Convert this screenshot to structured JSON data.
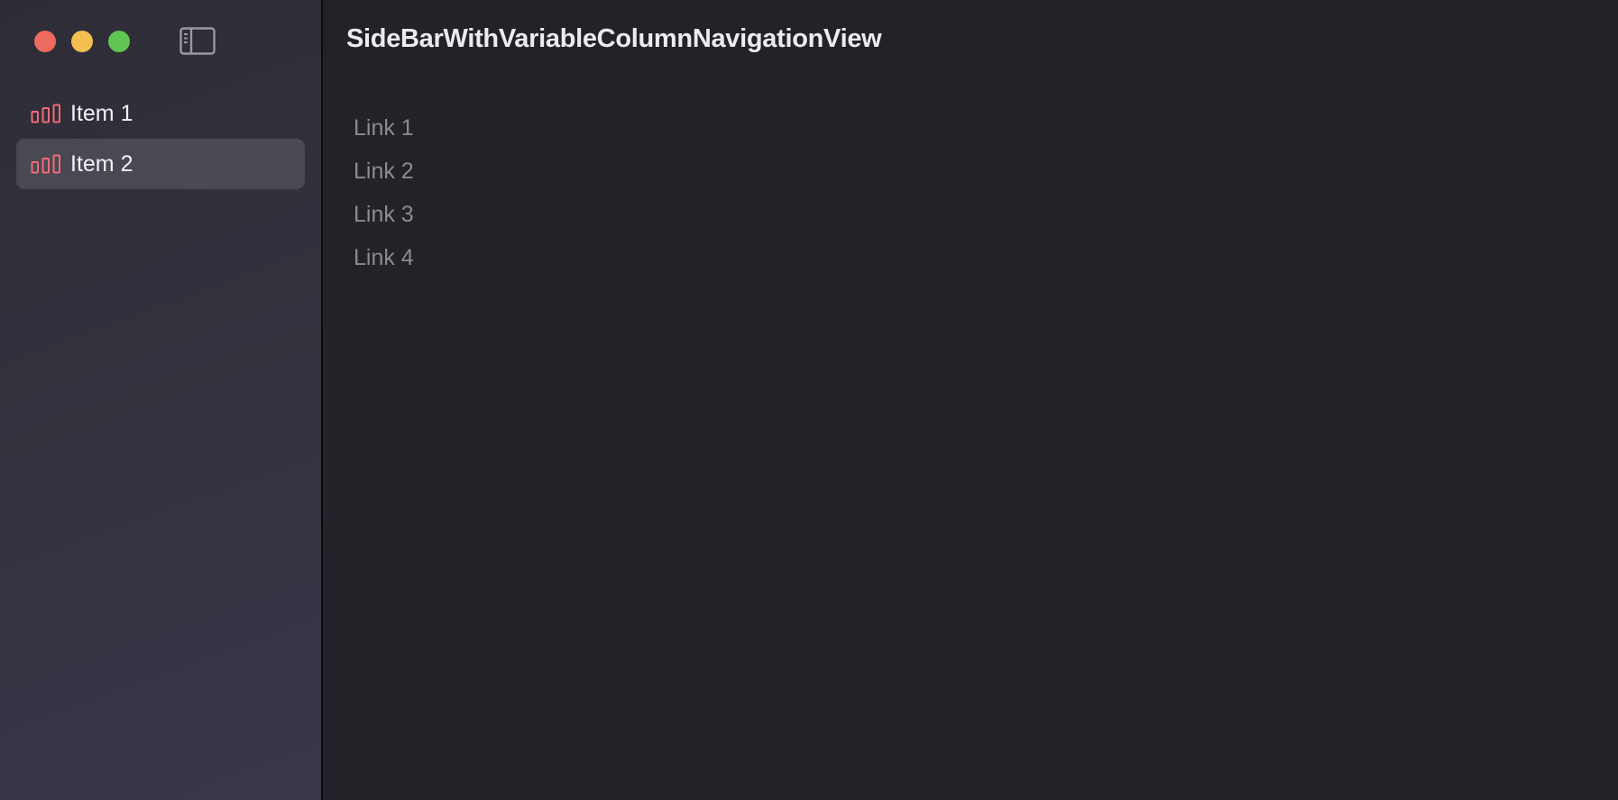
{
  "window": {
    "title": "SideBarWithVariableColumnNavigationView"
  },
  "traffic_lights": {
    "close_color": "#ed6a5e",
    "minimize_color": "#f5bf4f",
    "maximize_color": "#61c554"
  },
  "toolbar": {
    "sidebar_toggle_icon": "sidebar-left-icon"
  },
  "sidebar": {
    "accent_color": "#ef6b78",
    "selected_index": 1,
    "items": [
      {
        "label": "Item 1",
        "icon": "chart-bar-icon"
      },
      {
        "label": "Item 2",
        "icon": "chart-bar-icon"
      }
    ]
  },
  "content": {
    "links": [
      {
        "label": "Link 1"
      },
      {
        "label": "Link 2"
      },
      {
        "label": "Link 3"
      },
      {
        "label": "Link 4"
      }
    ]
  }
}
